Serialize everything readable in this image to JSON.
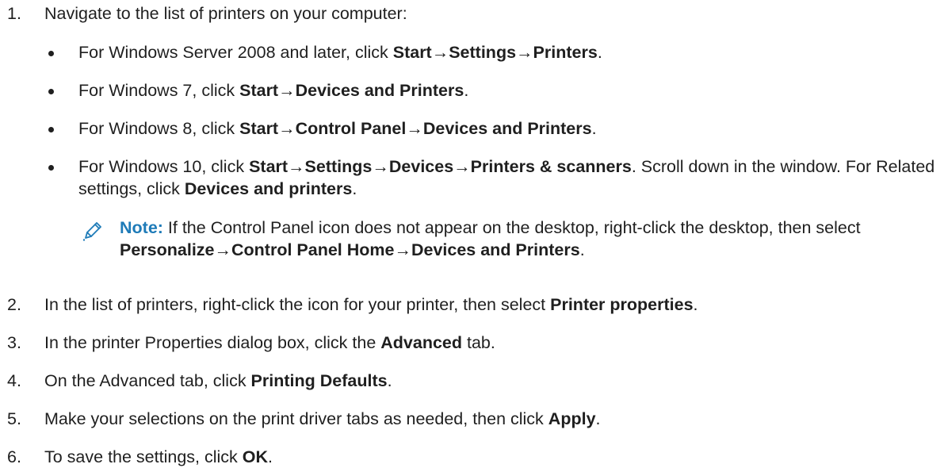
{
  "steps": [
    {
      "num": "1.",
      "parts": [
        {
          "t": "Navigate to the list of printers on your computer:",
          "b": false
        }
      ]
    },
    {
      "num": "2.",
      "parts": [
        {
          "t": "In the list of printers, right-click the icon for your printer, then select ",
          "b": false
        },
        {
          "t": "Printer properties",
          "b": true
        },
        {
          "t": ".",
          "b": false
        }
      ]
    },
    {
      "num": "3.",
      "parts": [
        {
          "t": "In the printer Properties dialog box, click the ",
          "b": false
        },
        {
          "t": "Advanced",
          "b": true
        },
        {
          "t": " tab.",
          "b": false
        }
      ]
    },
    {
      "num": "4.",
      "parts": [
        {
          "t": "On the Advanced tab, click ",
          "b": false
        },
        {
          "t": "Printing Defaults",
          "b": true
        },
        {
          "t": ".",
          "b": false
        }
      ]
    },
    {
      "num": "5.",
      "parts": [
        {
          "t": "Make your selections on the print driver tabs as needed, then click ",
          "b": false
        },
        {
          "t": "Apply",
          "b": true
        },
        {
          "t": ".",
          "b": false
        }
      ]
    },
    {
      "num": "6.",
      "parts": [
        {
          "t": "To save the settings, click ",
          "b": false
        },
        {
          "t": "OK",
          "b": true
        },
        {
          "t": ".",
          "b": false
        }
      ]
    }
  ],
  "bullets": [
    {
      "parts": [
        {
          "t": "For Windows Server 2008 and later, click ",
          "b": false
        },
        {
          "t": "Start",
          "b": true
        },
        {
          "t": "→",
          "b": false
        },
        {
          "t": "Settings",
          "b": true
        },
        {
          "t": "→",
          "b": false
        },
        {
          "t": "Printers",
          "b": true
        },
        {
          "t": ".",
          "b": false
        }
      ]
    },
    {
      "parts": [
        {
          "t": "For Windows 7, click ",
          "b": false
        },
        {
          "t": "Start",
          "b": true
        },
        {
          "t": "→",
          "b": false
        },
        {
          "t": "Devices and Printers",
          "b": true
        },
        {
          "t": ".",
          "b": false
        }
      ]
    },
    {
      "parts": [
        {
          "t": "For Windows 8, click ",
          "b": false
        },
        {
          "t": "Start",
          "b": true
        },
        {
          "t": "→",
          "b": false
        },
        {
          "t": "Control Panel",
          "b": true
        },
        {
          "t": "→",
          "b": false
        },
        {
          "t": "Devices and Printers",
          "b": true
        },
        {
          "t": ".",
          "b": false
        }
      ]
    },
    {
      "parts": [
        {
          "t": "For Windows 10, click ",
          "b": false
        },
        {
          "t": "Start",
          "b": true
        },
        {
          "t": "→",
          "b": false
        },
        {
          "t": "Settings",
          "b": true
        },
        {
          "t": "→",
          "b": false
        },
        {
          "t": "Devices",
          "b": true
        },
        {
          "t": "→",
          "b": false
        },
        {
          "t": "Printers & scanners",
          "b": true
        },
        {
          "t": ". Scroll down in the window. For Related settings, click ",
          "b": false
        },
        {
          "t": "Devices and printers",
          "b": true
        },
        {
          "t": ".",
          "b": false
        }
      ]
    }
  ],
  "note": {
    "icon": "pencil-icon",
    "label": "Note:",
    "parts": [
      {
        "t": " If the Control Panel icon does not appear on the desktop, right-click the desktop, then select ",
        "b": false
      },
      {
        "t": "Personalize",
        "b": true
      },
      {
        "t": "→",
        "b": false
      },
      {
        "t": "Control Panel Home",
        "b": true
      },
      {
        "t": "→",
        "b": false
      },
      {
        "t": "Devices and Printers",
        "b": true
      },
      {
        "t": ".",
        "b": false
      }
    ]
  },
  "colors": {
    "text": "#1f1f1f",
    "note_label": "#1e7bb8",
    "icon": "#1e7bb8"
  }
}
